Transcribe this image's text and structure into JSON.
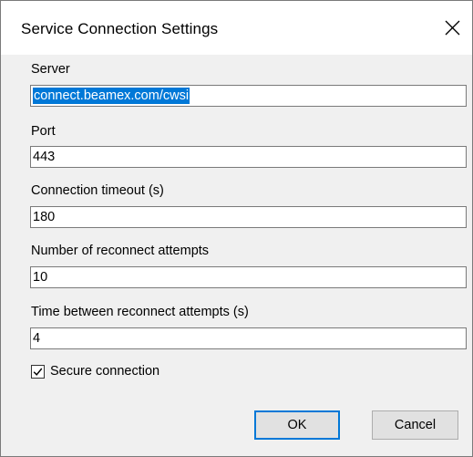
{
  "window": {
    "title": "Service Connection Settings",
    "close_icon": "close-icon"
  },
  "fields": {
    "server": {
      "label": "Server",
      "value": "connect.beamex.com/cwsi",
      "selected": true
    },
    "port": {
      "label": "Port",
      "value": "443"
    },
    "timeout": {
      "label": "Connection timeout (s)",
      "value": "180"
    },
    "reconnect_attempts": {
      "label": "Number of reconnect attempts",
      "value": "10"
    },
    "reconnect_interval": {
      "label": "Time between reconnect attempts (s)",
      "value": "4"
    }
  },
  "secure": {
    "label": "Secure connection",
    "checked": true,
    "icon": "checkmark-icon"
  },
  "buttons": {
    "ok": "OK",
    "cancel": "Cancel"
  },
  "colors": {
    "selection": "#0078d7",
    "default_button_border": "#0078d7",
    "dialog_background": "#f0f0f0"
  }
}
